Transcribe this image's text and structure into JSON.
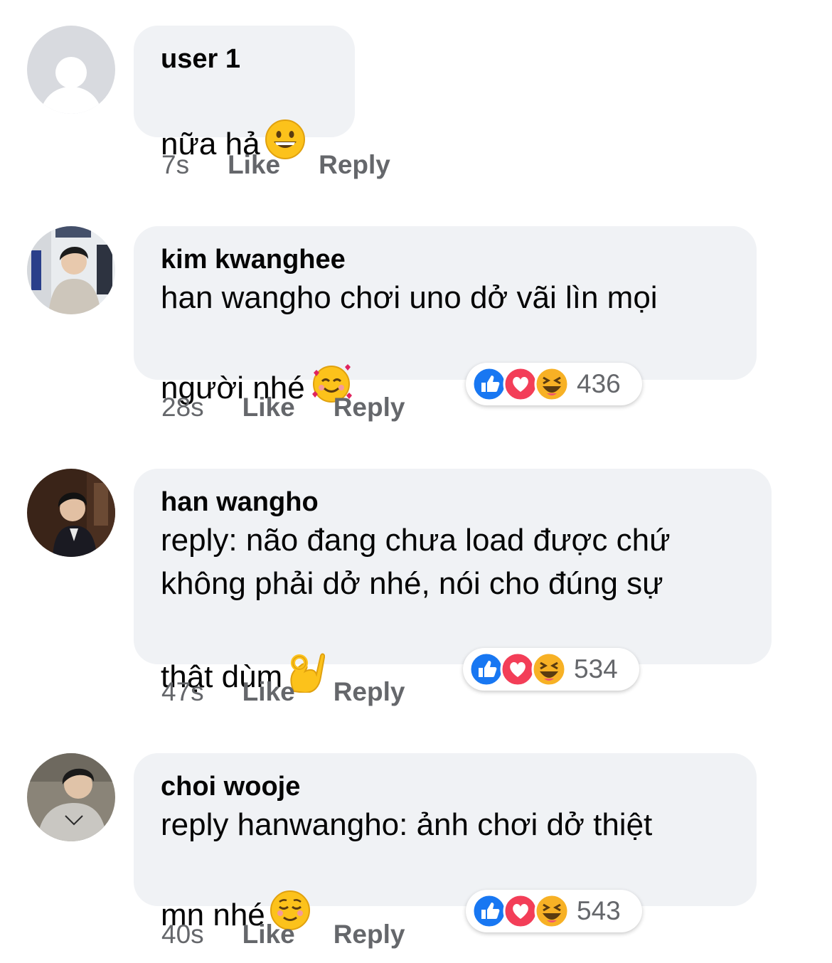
{
  "comments": [
    {
      "name": "user 1",
      "text": "nữa hả",
      "emoji": "grinning-face-emoji",
      "time": "7s",
      "like_label": "Like",
      "reply_label": "Reply",
      "avatar": "default-avatar"
    },
    {
      "name": "kim kwanghee",
      "text": "han wangho chơi uno dở vãi lìn mọi\nngười nhé",
      "emoji": "smiling-face-with-hearts-emoji",
      "time": "28s",
      "like_label": "Like",
      "reply_label": "Reply",
      "avatar": "photo-avatar",
      "reactions": {
        "icons": [
          "like-icon",
          "love-icon",
          "haha-icon"
        ],
        "count": "436"
      }
    },
    {
      "name": "han wangho",
      "text": "reply: não đang chưa load được chứ\nkhông phải dở nhé, nói cho đúng sự\nthật dùm",
      "emoji": "ok-hand-emoji",
      "time": "47s",
      "like_label": "Like",
      "reply_label": "Reply",
      "avatar": "photo-avatar",
      "reactions": {
        "icons": [
          "like-icon",
          "love-icon",
          "haha-icon"
        ],
        "count": "534"
      }
    },
    {
      "name": "choi wooje",
      "text": "reply hanwangho: ảnh chơi dở thiệt\nmn nhé",
      "emoji": "relieved-face-emoji",
      "time": "40s",
      "like_label": "Like",
      "reply_label": "Reply",
      "avatar": "photo-avatar",
      "reactions": {
        "icons": [
          "like-icon",
          "love-icon",
          "haha-icon"
        ],
        "count": "543"
      }
    }
  ],
  "colors": {
    "bubble": "#f0f2f5",
    "meta_text": "#65676b",
    "like_blue": "#1877f2",
    "love_red": "#f33e58",
    "haha_yellow": "#f7b125"
  }
}
